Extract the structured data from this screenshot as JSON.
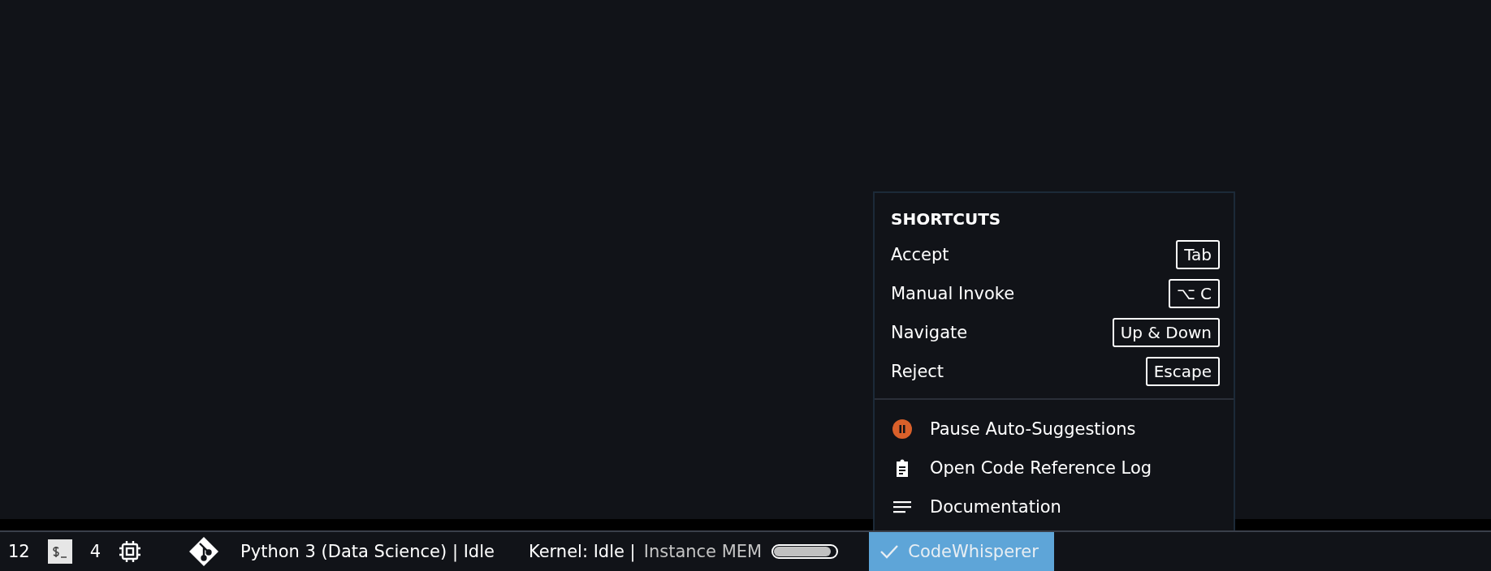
{
  "popup": {
    "heading": "SHORTCUTS",
    "shortcuts": [
      {
        "action": "Accept",
        "key": "Tab"
      },
      {
        "action": "Manual Invoke",
        "key": "⌥ C"
      },
      {
        "action": "Navigate",
        "key": "Up & Down"
      },
      {
        "action": "Reject",
        "key": "Escape"
      }
    ],
    "menu": [
      {
        "kind": "pause",
        "label": "Pause Auto-Suggestions"
      },
      {
        "kind": "log",
        "label": "Open Code Reference Log"
      },
      {
        "kind": "docs",
        "label": "Documentation"
      }
    ]
  },
  "status_bar": {
    "count_1": "12",
    "count_2": "4",
    "kernel_name": "Python 3 (Data Science) | Idle",
    "kernel_status": "Kernel: Idle |",
    "memory_label": "Instance MEM",
    "memory": {
      "level": 0.92
    },
    "codewhisperer": {
      "label": "CodeWhisperer",
      "selected": true
    }
  }
}
